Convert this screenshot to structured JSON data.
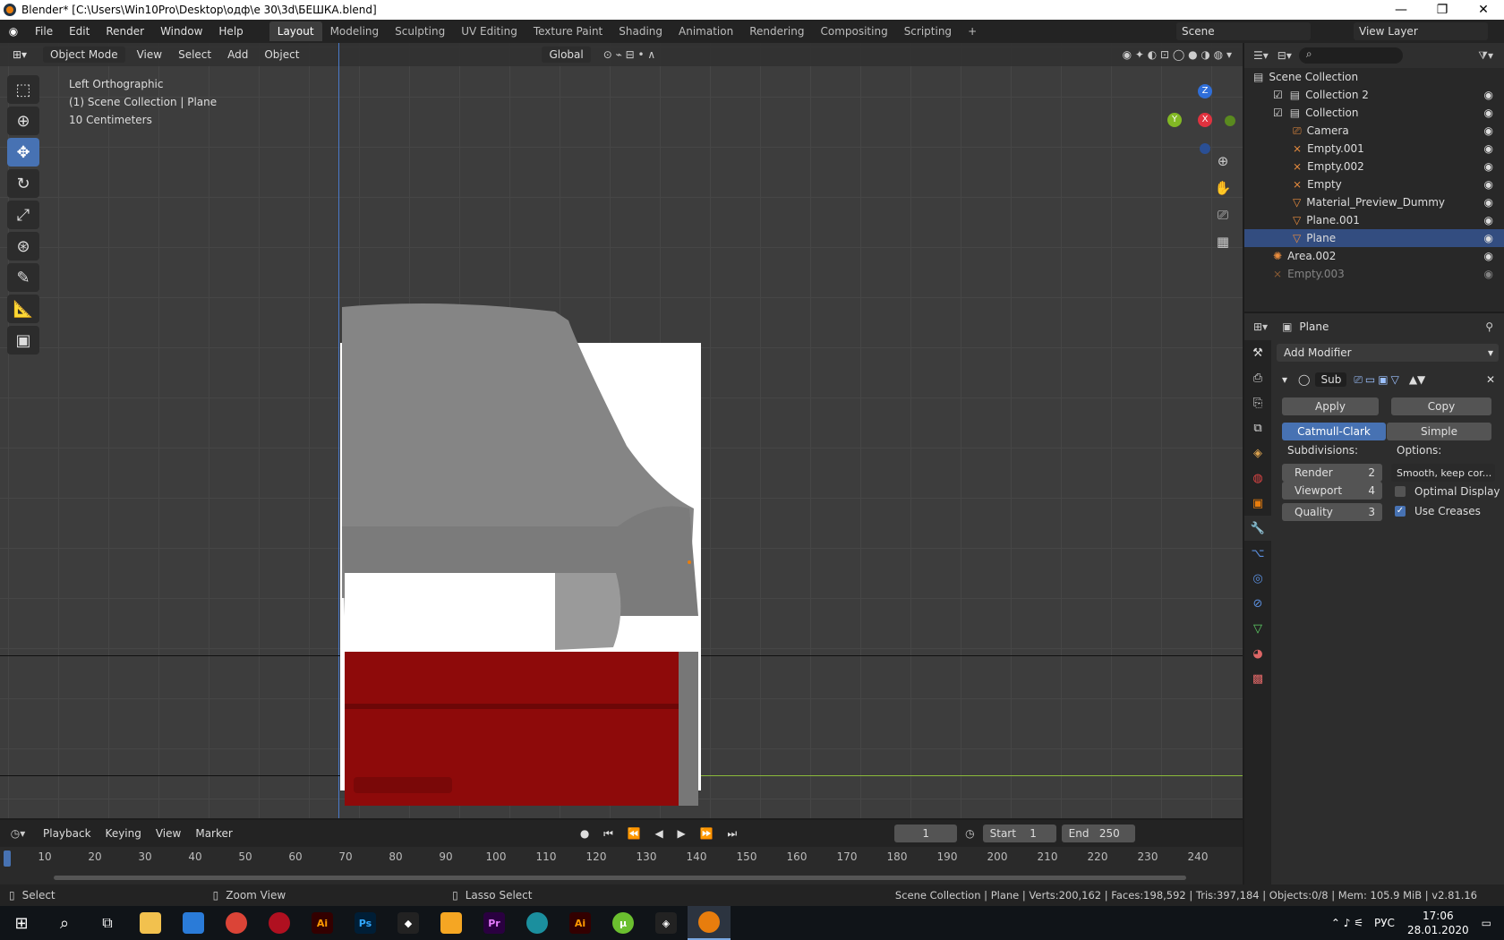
{
  "window": {
    "title": "Blender* [C:\\Users\\Win10Pro\\Desktop\\одф\\e 30\\3d\\БЕШКА.blend]",
    "min": "—",
    "max": "❐",
    "close": "✕"
  },
  "menu": [
    "File",
    "Edit",
    "Render",
    "Window",
    "Help"
  ],
  "workspaces": [
    "Layout",
    "Modeling",
    "Sculpting",
    "UV Editing",
    "Texture Paint",
    "Shading",
    "Animation",
    "Rendering",
    "Compositing",
    "Scripting",
    "+"
  ],
  "scene": {
    "name": "Scene",
    "view_layer": "View Layer"
  },
  "viewport": {
    "mode": "Object Mode",
    "menus": [
      "View",
      "Select",
      "Add",
      "Object"
    ],
    "transform": "Global",
    "overlay": [
      "Left Orthographic",
      "(1) Scene Collection | Plane",
      "10 Centimeters"
    ],
    "gizmo": {
      "z": "Z",
      "x": "X",
      "y": "Y"
    },
    "tools": [
      "select-box",
      "cursor",
      "move",
      "rotate",
      "scale",
      "transform",
      "annotate",
      "measure",
      "add-cube"
    ]
  },
  "outliner": {
    "search": "",
    "rows": [
      {
        "name": "Scene Collection",
        "indent": 0,
        "type": "collection"
      },
      {
        "name": "Collection 2",
        "indent": 1,
        "type": "collection",
        "check": true
      },
      {
        "name": "Collection",
        "indent": 1,
        "type": "collection",
        "check": true
      },
      {
        "name": "Camera",
        "indent": 2,
        "type": "camera"
      },
      {
        "name": "Empty.001",
        "indent": 2,
        "type": "empty"
      },
      {
        "name": "Empty.002",
        "indent": 2,
        "type": "empty"
      },
      {
        "name": "Empty",
        "indent": 2,
        "type": "empty"
      },
      {
        "name": "Material_Preview_Dummy",
        "indent": 2,
        "type": "mesh"
      },
      {
        "name": "Plane.001",
        "indent": 2,
        "type": "mesh"
      },
      {
        "name": "Plane",
        "indent": 2,
        "type": "mesh"
      },
      {
        "name": "Area.002",
        "indent": 1,
        "type": "light"
      },
      {
        "name": "Empty.003",
        "indent": 1,
        "type": "empty",
        "dim": true
      }
    ]
  },
  "properties": {
    "object": "Plane",
    "add_modifier": "Add Modifier",
    "mod_name": "Sub",
    "apply": "Apply",
    "copy": "Copy",
    "catmull": "Catmull-Clark",
    "simple": "Simple",
    "subdivisions": "Subdivisions:",
    "options": "Options:",
    "render_label": "Render",
    "render_val": "2",
    "viewport_label": "Viewport",
    "viewport_val": "4",
    "quality_label": "Quality",
    "quality_val": "3",
    "uv_smooth": "Smooth, keep cor...",
    "optimal": "Optimal Display",
    "creases": "Use Creases"
  },
  "timeline": {
    "menus": [
      "Playback",
      "Keying",
      "View",
      "Marker"
    ],
    "frame": "1",
    "start_label": "Start",
    "start": "1",
    "end_label": "End",
    "end": "250",
    "ticks": [
      "10",
      "20",
      "30",
      "40",
      "50",
      "60",
      "70",
      "80",
      "90",
      "100",
      "110",
      "120",
      "130",
      "140",
      "150",
      "160",
      "170",
      "180",
      "190",
      "200",
      "210",
      "220",
      "230",
      "240"
    ]
  },
  "status": {
    "left": "Select",
    "mid": "Zoom View",
    "lasso": "Lasso Select",
    "stats": "Scene Collection | Plane | Verts:200,162 | Faces:198,592 | Tris:397,184 | Objects:0/8 | Mem: 105.9 MiB | v2.81.16"
  },
  "taskbar": {
    "lang": "РУС",
    "time": "17:06",
    "date": "28.01.2020"
  },
  "colors": {
    "accent": "#4772b3",
    "car_red": "#8e0a0a",
    "orange": "#e87d0d"
  }
}
